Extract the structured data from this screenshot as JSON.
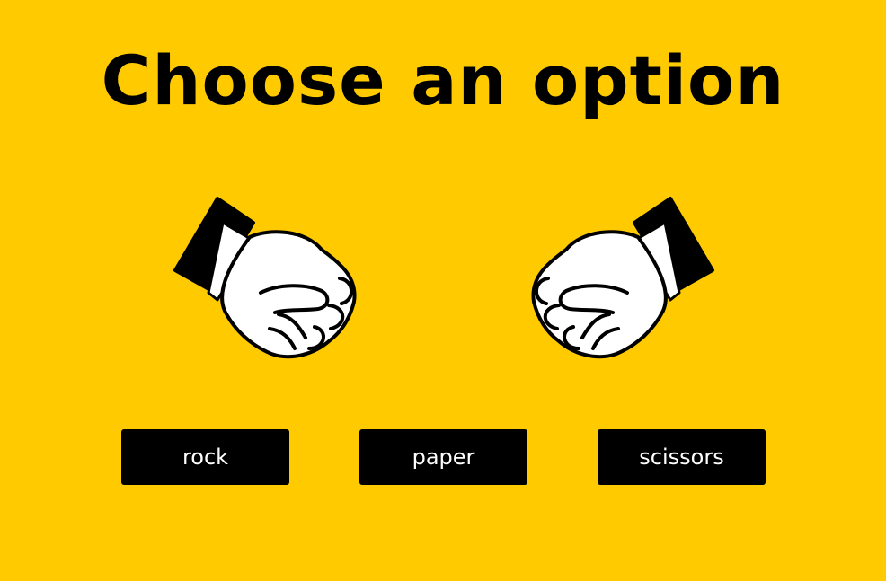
{
  "title": "Choose an option",
  "hands": {
    "left_icon": "fist-icon",
    "right_icon": "fist-icon"
  },
  "buttons": [
    {
      "label": "rock"
    },
    {
      "label": "paper"
    },
    {
      "label": "scissors"
    }
  ],
  "colors": {
    "background": "#FFCB00",
    "text": "#000000",
    "button_background": "#000000",
    "button_text": "#FFFFFF",
    "hand_fill": "#FFFFFF"
  }
}
